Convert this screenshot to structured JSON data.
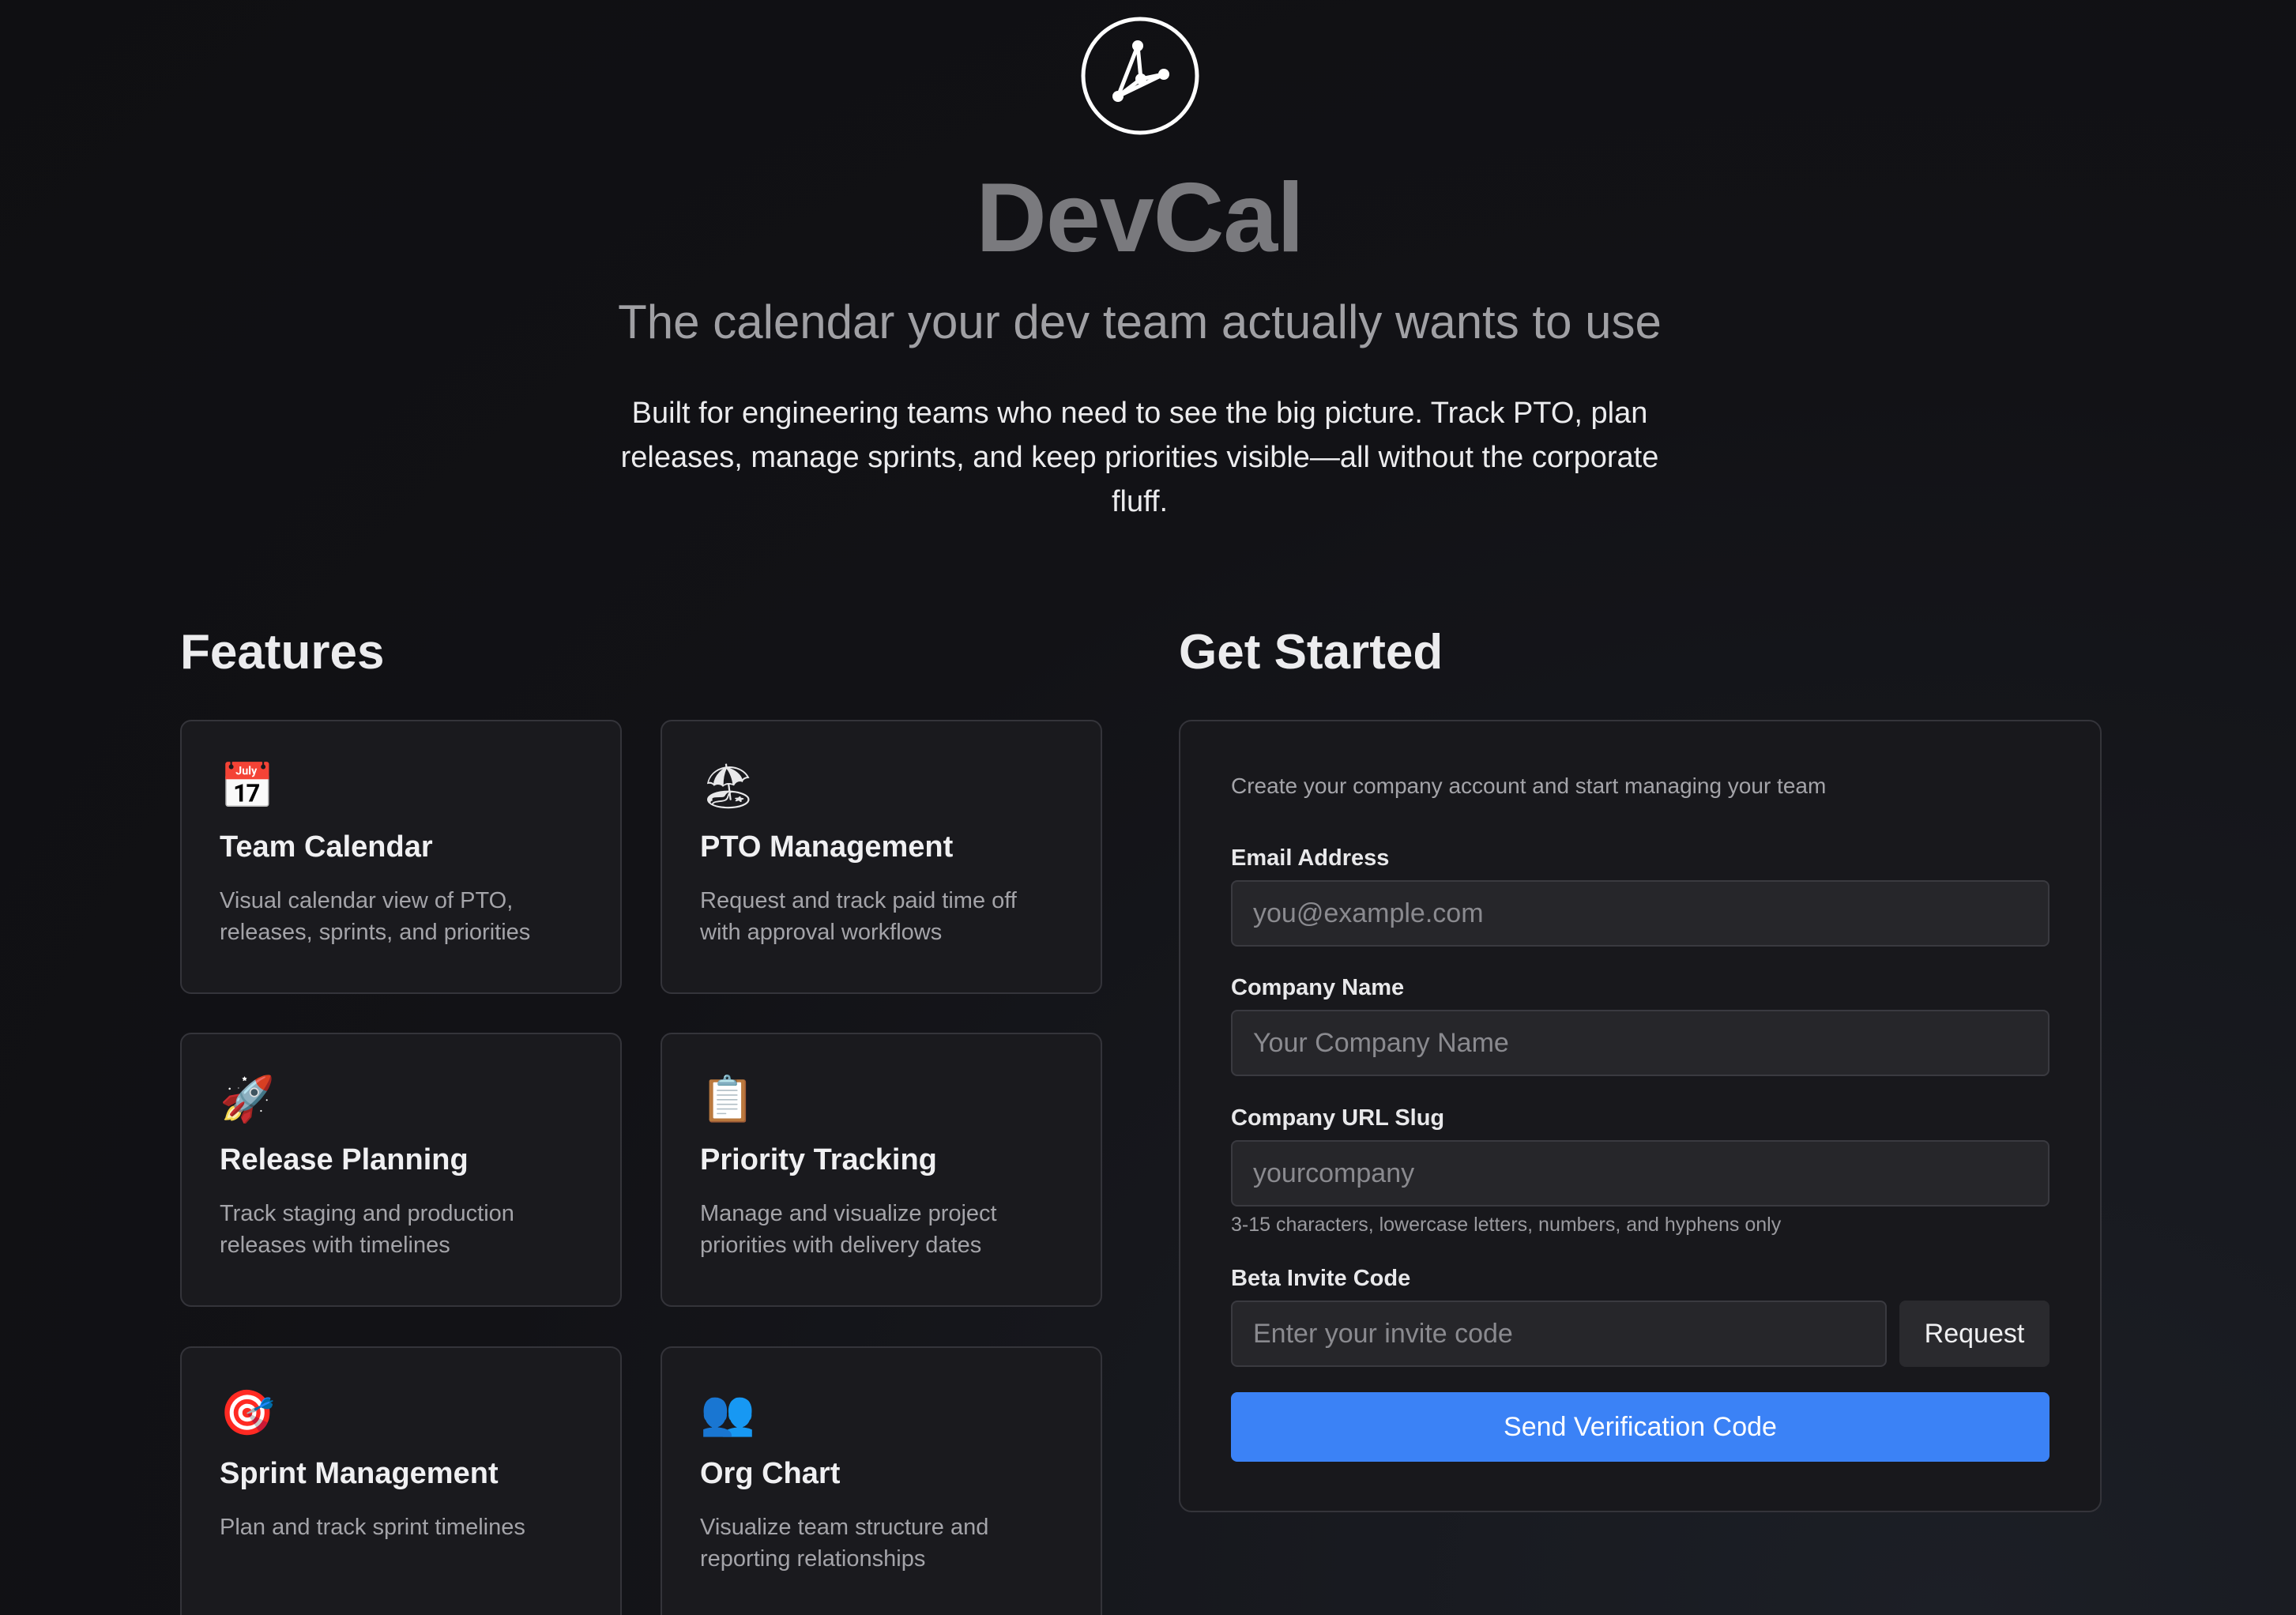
{
  "hero": {
    "brand": "DevCal",
    "tagline": "The calendar your dev team actually wants to use",
    "intro": "Built for engineering teams who need to see the big picture. Track PTO, plan releases, manage sprints, and keep priorities visible—all without the corporate fluff.",
    "logo_icon": "network-nodes-icon"
  },
  "features": {
    "title": "Features",
    "items": [
      {
        "icon": "📅",
        "icon_name": "calendar-icon",
        "title": "Team Calendar",
        "description": "Visual calendar view of PTO, releases, sprints, and priorities"
      },
      {
        "icon": "🏖",
        "icon_name": "beach-umbrella-icon",
        "title": "PTO Management",
        "description": "Request and track paid time off with approval workflows"
      },
      {
        "icon": "🚀",
        "icon_name": "rocket-icon",
        "title": "Release Planning",
        "description": "Track staging and production releases with timelines"
      },
      {
        "icon": "📋",
        "icon_name": "clipboard-icon",
        "title": "Priority Tracking",
        "description": "Manage and visualize project priorities with delivery dates"
      },
      {
        "icon": "🎯",
        "icon_name": "target-icon",
        "title": "Sprint Management",
        "description": "Plan and track sprint timelines"
      },
      {
        "icon": "👥",
        "icon_name": "people-icon",
        "title": "Org Chart",
        "description": "Visualize team structure and reporting relationships"
      }
    ]
  },
  "signup": {
    "title": "Get Started",
    "description": "Create your company account and start managing your team",
    "email_label": "Email Address",
    "email_placeholder": "you@example.com",
    "company_label": "Company Name",
    "company_placeholder": "Your Company Name",
    "slug_label": "Company URL Slug",
    "slug_placeholder": "yourcompany",
    "slug_hint": "3-15 characters, lowercase letters, numbers, and hyphens only",
    "invite_label": "Beta Invite Code",
    "invite_placeholder": "Enter your invite code",
    "request_label": "Request",
    "submit_label": "Send Verification Code"
  },
  "colors": {
    "background": "#111114",
    "card": "#1a1a1e",
    "accent": "#3b82f6"
  }
}
